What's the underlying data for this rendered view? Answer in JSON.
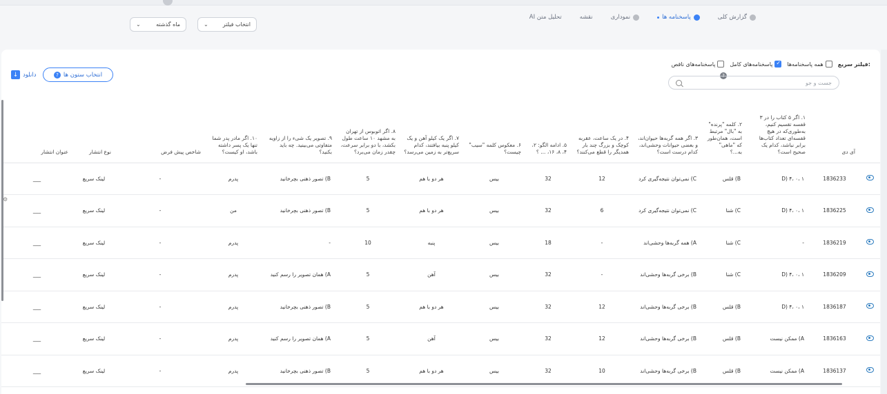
{
  "header": {
    "tabs": [
      {
        "label": "گزارش کلی",
        "active": false
      },
      {
        "label": "پاسخنامه ها",
        "active": true
      },
      {
        "label": "نموداری",
        "active": false
      },
      {
        "label": "نقشه",
        "active": false
      },
      {
        "label": "تحلیل متن AI",
        "active": false
      }
    ],
    "filter_select": {
      "placeholder": "انتخاب فیلتر"
    },
    "period_select": {
      "value": "ماه گذشته"
    }
  },
  "quick_filter": {
    "label": "فیلتر سریع:",
    "options": [
      {
        "label": "همه پاسخنامه‌ها",
        "checked": false
      },
      {
        "label": "پاسخنامه‌های کامل",
        "checked": true
      },
      {
        "label": "پاسخنامه‌های ناقص",
        "checked": false
      }
    ]
  },
  "search": {
    "placeholder": "جست و جو"
  },
  "toolbar": {
    "columns_button": "انتخاب ستون ها",
    "download_button": "دانلود"
  },
  "table": {
    "headers": [
      "آی دی",
      "۱. اگر ۵ کتاب را در ۳ قفسه تقسیم کنیم، به‌طوری‌که در هیچ قفسه‌ای تعداد کتاب‌ها برابر نباشد، کدام یک صحیح است؟",
      "۲. کلمه \"پرنده\" به \"بال\" مرتبط است، همان‌طور که \"ماهی\" به...؟",
      "۳. اگر همه گربه‌ها حیوان‌اند، و بعضی حیوانات وحشی‌اند، کدام درست است؟",
      "۴. در یک ساعت، عقربه کوچک و بزرگ چند بار همدیگر را قطع می‌کنند؟",
      "۵. ادامه الگو: ۲، ۴، ۸، ۱۶، ... ؟",
      "۶. معکوس کلمه \"سیب\" چیست؟",
      "۷. اگر یک کیلو آهن و یک کیلو پنبه بیافتند، کدام سریع‌تر به زمین می‌رسد؟",
      "۸. اگر اتوبوس از تهران به مشهد ۱۰ ساعت طول بکشد، با دو برابر سرعت، چقدر زمان می‌برد؟",
      "۹. تصویر یک شیء را از زاویه متفاوتی می‌بینید. چه باید بکنید؟",
      "۱۰. اگر مادر پدر شما تنها یک پسر داشته باشد، او کیست؟",
      "شاخص پیش فرض",
      "نوع انتشار",
      "عنوان انتشار"
    ],
    "rows": [
      [
        "1836233",
        "D) ۴، ۰، ۱",
        "B) قلس",
        "C) نمی‌توان نتیجه‌گیری کرد",
        "12",
        "32",
        "بیس",
        "هر دو با هم",
        "5",
        "B) تصور ذهنی بچرخانید",
        "پدرم",
        "-",
        "لینک سریع",
        "___"
      ],
      [
        "1836225",
        "D) ۴، ۰، ۱",
        "C) شنا",
        "C) نمی‌توان نتیجه‌گیری کرد",
        "6",
        "32",
        "بیس",
        "هر دو با هم",
        "5",
        "B) تصور ذهنی بچرخانید",
        "من",
        "-",
        "لینک سریع",
        "___"
      ],
      [
        "1836219",
        "-",
        "C) شنا",
        "A) همه گربه‌ها وحشی‌اند",
        "-",
        "18",
        "بیس",
        "پنبه",
        "10",
        "-",
        "پدرم",
        "-",
        "لینک سریع",
        "___"
      ],
      [
        "1836209",
        "D) ۴، ۰، ۱",
        "C) شنا",
        "B) برخی گربه‌ها وحشی‌اند",
        "-",
        "32",
        "بیس",
        "آهن",
        "5",
        "A) همان تصویر را رسم کنید",
        "پدرم",
        "-",
        "لینک سریع",
        "___"
      ],
      [
        "1836187",
        "D) ۴، ۰، ۱",
        "B) قلس",
        "B) برخی گربه‌ها وحشی‌اند",
        "12",
        "32",
        "بیس",
        "هر دو با هم",
        "5",
        "B) تصور ذهنی بچرخانید",
        "پدرم",
        "-",
        "لینک سریع",
        "___"
      ],
      [
        "1836163",
        "A) ممکن نیست",
        "B) قلس",
        "B) برخی گربه‌ها وحشی‌اند",
        "12",
        "32",
        "بیس",
        "آهن",
        "5",
        "A) همان تصویر را رسم کنید",
        "پدرم",
        "-",
        "لینک سریع",
        "___"
      ],
      [
        "1836137",
        "A) ممکن نیست",
        "B) قلس",
        "B) برخی گربه‌ها وحشی‌اند",
        "10",
        "32",
        "بیس",
        "هر دو با هم",
        "5",
        "B) تصور ذهنی بچرخانید",
        "پدرم",
        "-",
        "لینک سریع",
        "___"
      ]
    ]
  }
}
